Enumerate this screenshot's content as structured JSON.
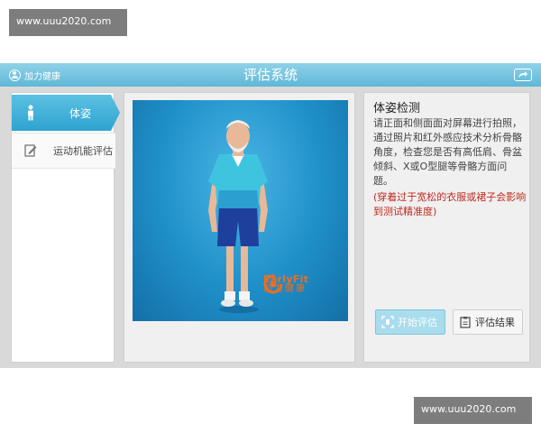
{
  "watermark": {
    "top_text": "www.uuu2020.com",
    "bottom_text": "www.uuu2020.com"
  },
  "header": {
    "brand_label": "加力健康",
    "title": "评估系统",
    "share_icon": "share-icon"
  },
  "sidebar": {
    "items": [
      {
        "label": "体姿",
        "icon": "person-icon",
        "active": true
      },
      {
        "label": "运动机能评估",
        "icon": "edit-icon",
        "active": false
      }
    ]
  },
  "stage": {
    "logo_en": "EarlyFit",
    "logo_cn": "加力健康",
    "background_color": "#1f8fc9"
  },
  "info": {
    "title": "体姿检测",
    "description": "请正面和侧面面对屏幕进行拍照，通过照片和红外感应技术分析骨骼角度，检查您是否有高低肩、骨盆倾斜、X或O型腿等骨骼方面问题。",
    "warning": "(穿着过于宽松的衣服或裙子会影响到测试精准度)",
    "warning_color": "#c02a1f"
  },
  "actions": {
    "start_label": "开始评估",
    "result_label": "评估结果"
  },
  "colors": {
    "accent": "#2ea3cf",
    "titlebar": "#6cc0dc"
  }
}
